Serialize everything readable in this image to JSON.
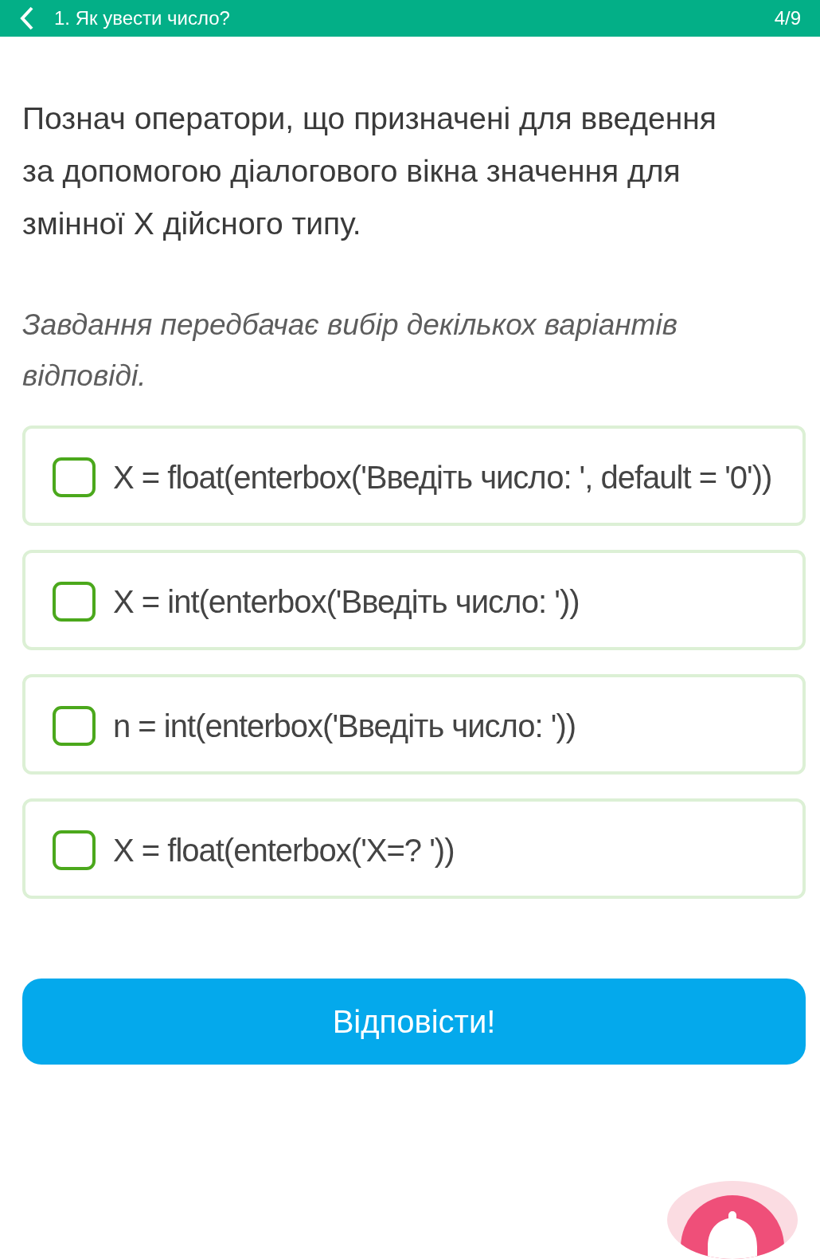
{
  "header": {
    "title": "1. Як увести число?",
    "progress": "4/9"
  },
  "question": "Познач оператори, що призначені для введення за допомогою діалогового вікна значення для змінної X дійсного типу.",
  "hint": "Завдання передбачає вибір декількох варіантів відповіді.",
  "options": [
    {
      "text": "X = float(enterbox('Введіть число: ', default = '0'))",
      "checked": false
    },
    {
      "text": "X = int(enterbox('Введіть число: '))",
      "checked": false
    },
    {
      "text": "n = int(enterbox('Введіть число: '))",
      "checked": false
    },
    {
      "text": "X = float(enterbox('X=? '))",
      "checked": false
    }
  ],
  "submit_button": "Відповісти!"
}
